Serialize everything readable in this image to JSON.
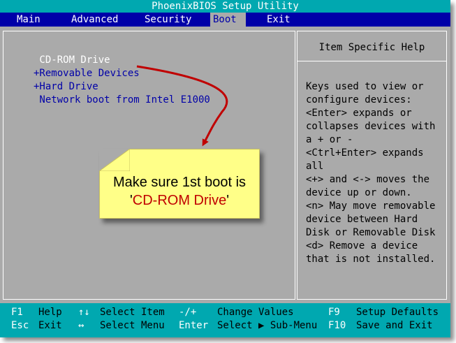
{
  "title": "PhoenixBIOS Setup Utility",
  "menu": {
    "items": [
      {
        "label": "Main"
      },
      {
        "label": "Advanced"
      },
      {
        "label": "Security"
      },
      {
        "label": "Boot"
      },
      {
        "label": "Exit"
      }
    ],
    "active": "Boot"
  },
  "boot_list": {
    "items": [
      {
        "label": " CD-ROM Drive",
        "selected": true
      },
      {
        "label": "+Removable Devices",
        "selected": false
      },
      {
        "label": "+Hard Drive",
        "selected": false
      },
      {
        "label": " Network boot from Intel E1000",
        "selected": false
      }
    ]
  },
  "help": {
    "title": "Item Specific Help",
    "lines": [
      "Keys used to view or",
      "configure devices:",
      "<Enter> expands or",
      "collapses devices with",
      "a + or -",
      "<Ctrl+Enter> expands",
      "all",
      "<+> and <-> moves the",
      "device up or down.",
      "<n> May move removable",
      "device between Hard",
      "Disk or Removable Disk",
      "<d> Remove a device",
      "that is not installed."
    ]
  },
  "status": {
    "row1": {
      "k1": "F1",
      "d1": "Help",
      "k2": "↑↓",
      "d2": "Select Item",
      "k3": "-/+",
      "d3": "Change Values",
      "k4": "F9",
      "d4": "Setup Defaults"
    },
    "row2": {
      "k1": "Esc",
      "d1": "Exit",
      "k2": "↔",
      "d2": "Select Menu",
      "k3": "Enter",
      "d3": "Select ▶ Sub-Menu",
      "k4": "F10",
      "d4": "Save and Exit"
    }
  },
  "callout": {
    "line1": "Make sure 1st boot is",
    "line2_prefix": "'",
    "line2_highlight": "CD-ROM Drive",
    "line2_suffix": "'"
  },
  "colors": {
    "bios_gray": "#aaaaaa",
    "bios_blue": "#0000a8",
    "bios_cyan": "#00a8b0",
    "note_yellow": "#ffff88",
    "annotation_red": "#c00000"
  }
}
